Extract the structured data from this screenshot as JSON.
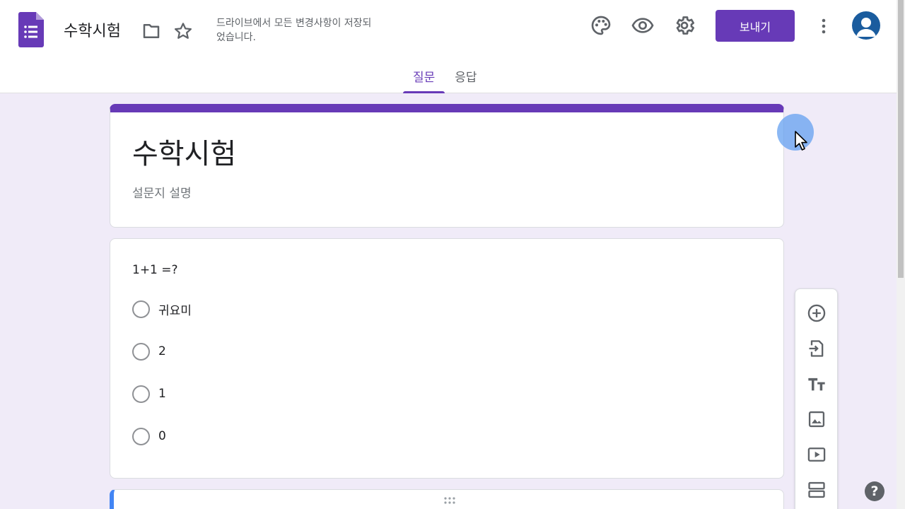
{
  "header": {
    "doc_title": "수학시험",
    "save_status": "드라이브에서 모든 변경사항이 저장되었습니다.",
    "send_label": "보내기",
    "icons": [
      "forms-app-icon",
      "folder-icon",
      "star-icon",
      "palette-icon",
      "eye-icon",
      "gear-icon",
      "more-vert-icon",
      "account-icon"
    ]
  },
  "tabs": [
    {
      "label": "질문",
      "active": true
    },
    {
      "label": "응답",
      "active": false
    }
  ],
  "form": {
    "title": "수학시험",
    "description_placeholder": "설문지 설명"
  },
  "question": {
    "text": "1+1 =?",
    "options": [
      "귀요미",
      "2",
      "1",
      "0"
    ]
  },
  "toolbar": {
    "items": [
      "add-question-icon",
      "import-questions-icon",
      "add-title-icon",
      "add-image-icon",
      "add-video-icon",
      "add-section-icon"
    ]
  },
  "colors": {
    "accent": "#673ab7",
    "background": "#f0ebf8",
    "next_card_accent": "#4285f4"
  }
}
